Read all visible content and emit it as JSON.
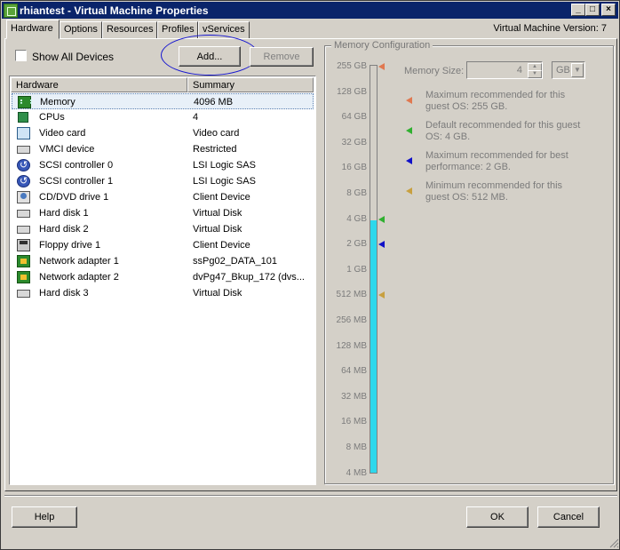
{
  "window": {
    "title": "rhiantest - Virtual Machine Properties"
  },
  "tabs": [
    {
      "label": "Hardware"
    },
    {
      "label": "Options"
    },
    {
      "label": "Resources"
    },
    {
      "label": "Profiles"
    },
    {
      "label": "vServices"
    }
  ],
  "vm_version": "Virtual Machine Version: 7",
  "show_all_devices": {
    "label": "Show All Devices",
    "checked": false
  },
  "buttons": {
    "add": "Add...",
    "remove": "Remove",
    "help": "Help",
    "ok": "OK",
    "cancel": "Cancel"
  },
  "hardware_table": {
    "headers": [
      "Hardware",
      "Summary"
    ],
    "selected_index": 0,
    "rows": [
      {
        "name": "Memory",
        "summary": "4096 MB",
        "icon": "memory-icon"
      },
      {
        "name": "CPUs",
        "summary": "4",
        "icon": "cpu-icon"
      },
      {
        "name": "Video card",
        "summary": "Video card",
        "icon": "video-card-icon"
      },
      {
        "name": "VMCI device",
        "summary": "Restricted",
        "icon": "vmci-device-icon"
      },
      {
        "name": "SCSI controller 0",
        "summary": "LSI Logic SAS",
        "icon": "scsi-controller-icon"
      },
      {
        "name": "SCSI controller 1",
        "summary": "LSI Logic SAS",
        "icon": "scsi-controller-icon"
      },
      {
        "name": "CD/DVD drive 1",
        "summary": "Client Device",
        "icon": "cd-dvd-icon"
      },
      {
        "name": "Hard disk 1",
        "summary": "Virtual Disk",
        "icon": "hard-disk-icon"
      },
      {
        "name": "Hard disk 2",
        "summary": "Virtual Disk",
        "icon": "hard-disk-icon"
      },
      {
        "name": "Floppy drive 1",
        "summary": "Client Device",
        "icon": "floppy-drive-icon"
      },
      {
        "name": "Network adapter 1",
        "summary": "ssPg02_DATA_101",
        "icon": "network-adapter-icon"
      },
      {
        "name": "Network adapter 2",
        "summary": "dvPg47_Bkup_172 (dvs...",
        "icon": "network-adapter-icon"
      },
      {
        "name": "Hard disk 3",
        "summary": "Virtual Disk",
        "icon": "hard-disk-icon"
      }
    ]
  },
  "memory_config": {
    "title": "Memory Configuration",
    "scale_labels": [
      "255 GB",
      "128 GB",
      "64 GB",
      "32 GB",
      "16 GB",
      "8 GB",
      "4 GB",
      "2 GB",
      "1 GB",
      "512 MB",
      "256 MB",
      "128 MB",
      "64 MB",
      "32 MB",
      "16 MB",
      "8 MB",
      "4 MB"
    ],
    "current_level": "4 GB",
    "memory_size_label": "Memory Size:",
    "memory_size_value": "4",
    "unit": "GB",
    "legend": [
      {
        "text": "Maximum recommended for this guest OS: 255 GB.",
        "color": "#e07850",
        "level": "255 GB"
      },
      {
        "text": "Default recommended for this guest OS: 4 GB.",
        "color": "#30b030",
        "level": "4 GB"
      },
      {
        "text": "Maximum recommended for best performance: 2 GB.",
        "color": "#1010c8",
        "level": "2 GB"
      },
      {
        "text": "Minimum recommended for this guest OS: 512 MB.",
        "color": "#c8a040",
        "level": "512 MB"
      }
    ],
    "fill_color": "#2dd8ec"
  }
}
